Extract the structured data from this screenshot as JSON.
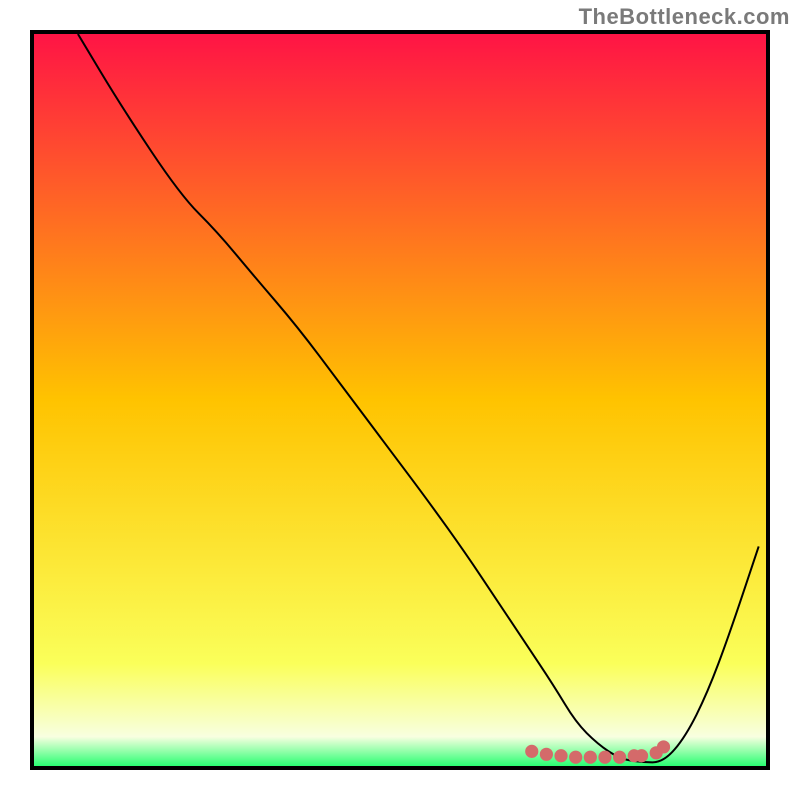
{
  "watermark": "TheBottleneck.com",
  "chart_data": {
    "type": "line",
    "title": "",
    "xlabel": "",
    "ylabel": "",
    "xlim": [
      0,
      100
    ],
    "ylim": [
      0,
      100
    ],
    "grid": false,
    "legend": false,
    "gradient_stops": [
      {
        "offset": 0,
        "color": "#ff1445"
      },
      {
        "offset": 50,
        "color": "#ffc300"
      },
      {
        "offset": 86,
        "color": "#faff5a"
      },
      {
        "offset": 96,
        "color": "#f8ffe0"
      },
      {
        "offset": 100,
        "color": "#29ff72"
      }
    ],
    "series": [
      {
        "name": "bottleneck-curve",
        "color": "#000000",
        "x": [
          6,
          12,
          20,
          25,
          30,
          36,
          42,
          48,
          54,
          59,
          63,
          67,
          71,
          74,
          77,
          80,
          83,
          86,
          89,
          92,
          95,
          99
        ],
        "y": [
          100,
          90,
          78,
          73,
          67,
          60,
          52,
          44,
          36,
          29,
          23,
          17,
          11,
          6,
          3,
          1,
          0.5,
          0.5,
          4,
          10,
          18,
          30
        ]
      },
      {
        "name": "optimal-range-marker",
        "color": "#d46a6a",
        "x": [
          68,
          70,
          72,
          74,
          76,
          78,
          80,
          82,
          83,
          85,
          86
        ],
        "y": [
          2.0,
          1.6,
          1.4,
          1.2,
          1.2,
          1.2,
          1.2,
          1.4,
          1.4,
          1.8,
          2.6
        ]
      }
    ]
  }
}
